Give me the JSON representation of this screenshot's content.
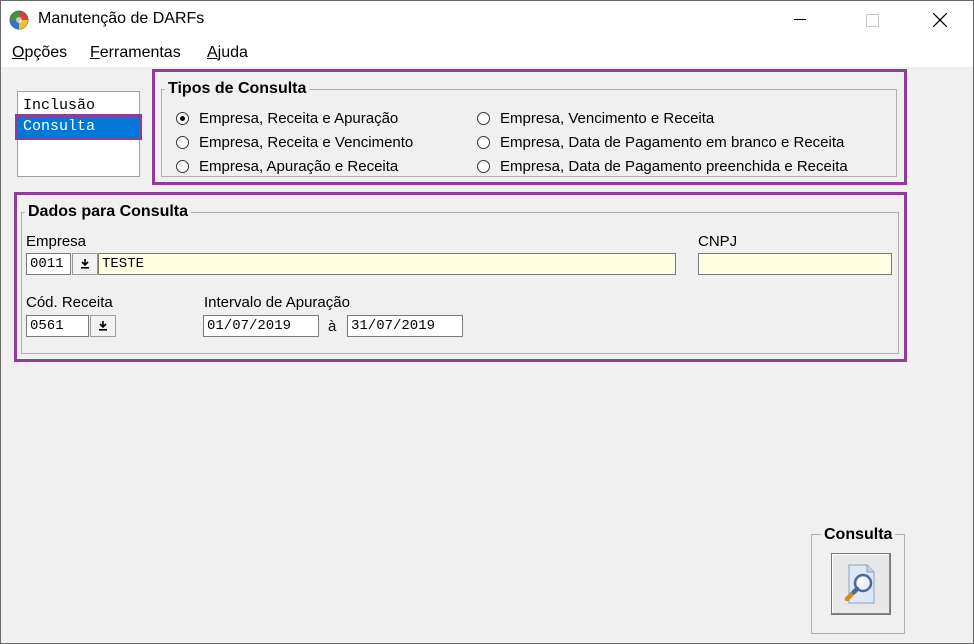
{
  "window": {
    "title": "Manutenção de DARFs",
    "accent_color": "#8f3c9b",
    "selection_color": "#0078d7",
    "field_color": "#ffffe1"
  },
  "menu": {
    "items": [
      {
        "underline": "O",
        "rest": "pções"
      },
      {
        "underline": "F",
        "rest": "erramentas"
      },
      {
        "underline": "A",
        "rest": "juda"
      }
    ]
  },
  "modes": {
    "items": [
      "Inclusão",
      "Consulta"
    ],
    "selected": "Consulta"
  },
  "tipos": {
    "title": "Tipos de Consulta",
    "options": [
      {
        "label": "Empresa, Receita e Apuração",
        "checked": true
      },
      {
        "label": "Empresa, Receita e Vencimento",
        "checked": false
      },
      {
        "label": "Empresa, Apuração e Receita",
        "checked": false
      },
      {
        "label": "Empresa, Vencimento e Receita",
        "checked": false
      },
      {
        "label": "Empresa, Data de Pagamento em branco e Receita",
        "checked": false
      },
      {
        "label": "Empresa, Data de Pagamento preenchida e Receita",
        "checked": false
      }
    ]
  },
  "dados": {
    "title": "Dados para Consulta",
    "empresa_label": "Empresa",
    "empresa_code": "0011",
    "empresa_name": "TESTE",
    "cnpj_label": "CNPJ",
    "cnpj_value": "",
    "receita_label": "Cód. Receita",
    "receita_code": "0561",
    "intervalo_label": "Intervalo de Apuração",
    "date_from": "01/07/2019",
    "date_sep": "à",
    "date_to": "31/07/2019"
  },
  "action": {
    "title": "Consulta",
    "icon": "magnifier-document-icon"
  }
}
